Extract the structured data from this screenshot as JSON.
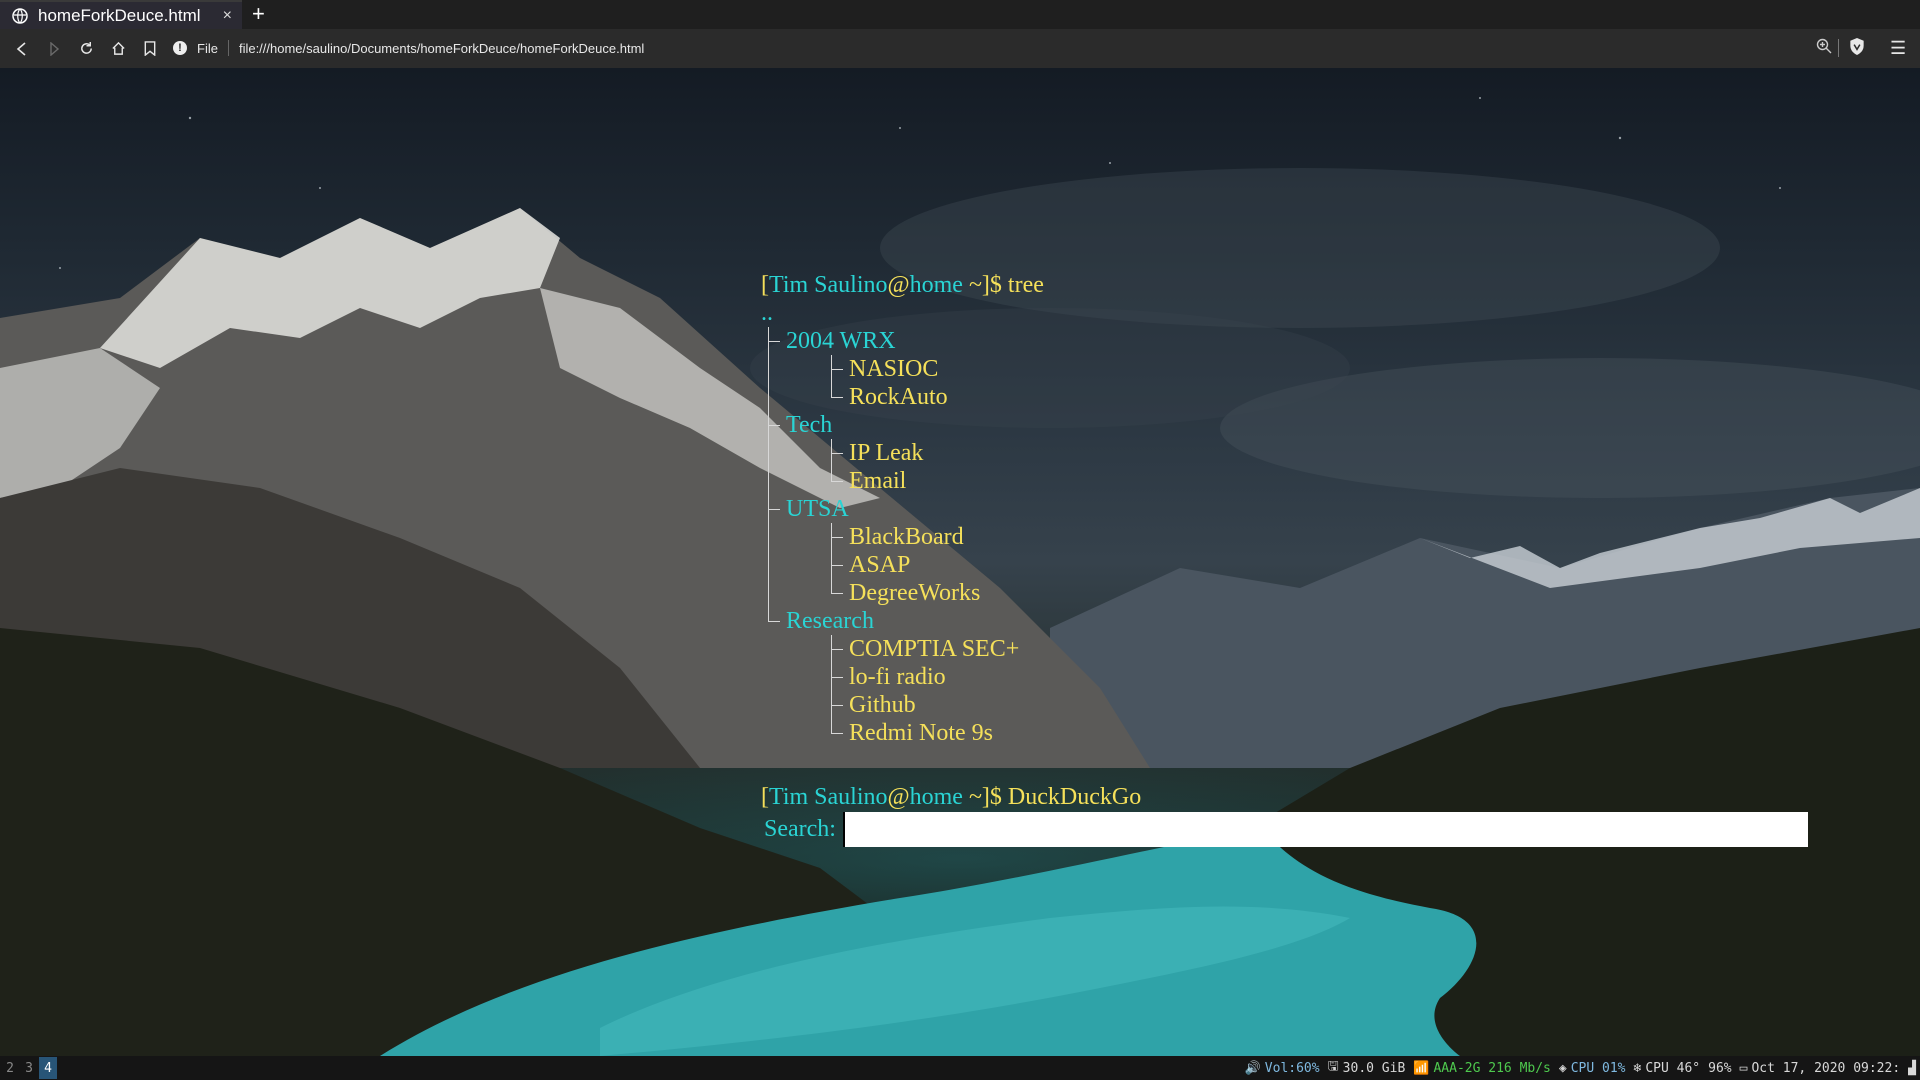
{
  "browser": {
    "tab_title": "homeForkDeuce.html",
    "tab_close": "×",
    "new_tab": "+",
    "file_label": "File",
    "url": "file:///home/saulino/Documents/homeForkDeuce/homeForkDeuce.html"
  },
  "terminal": {
    "prompt1": {
      "open": "[",
      "user": "Tim Saulino",
      "at": "@",
      "host": "home",
      "rest": " ~]$ tree"
    },
    "root": "..",
    "tree": [
      {
        "label": "2004 WRX",
        "color": "cyan",
        "links": [
          "NASIOC",
          "RockAuto"
        ]
      },
      {
        "label": "Tech",
        "color": "cyan",
        "links": [
          "IP Leak",
          "Email"
        ]
      },
      {
        "label": "UTSA",
        "color": "cyan",
        "links": [
          "BlackBoard",
          "ASAP",
          "DegreeWorks"
        ]
      },
      {
        "label": "Research",
        "color": "cyan",
        "links": [
          "COMPTIA SEC+",
          "lo-fi radio",
          "Github",
          "Redmi Note 9s"
        ]
      }
    ],
    "prompt2": {
      "open": "[",
      "user": "Tim Saulino",
      "at": "@",
      "host": "home",
      "rest": " ~]$ DuckDuckGo"
    },
    "search_label": "Search:",
    "search_value": ""
  },
  "statusbar": {
    "workspaces": [
      "2",
      "3",
      "4"
    ],
    "active_workspace": "4",
    "volume": "Vol:60%",
    "disk": "30.0 GiB",
    "wifi": "AAA-2G 216 Mb/s",
    "cpu_usage": "CPU 01%",
    "cpu_temp": "CPU 46°",
    "battery": "96%",
    "datetime": "Oct 17, 2020 09:22:"
  },
  "colors": {
    "cyan": "#2ad4d4",
    "yellow": "#f5e05a",
    "active_ws": "#285577"
  }
}
